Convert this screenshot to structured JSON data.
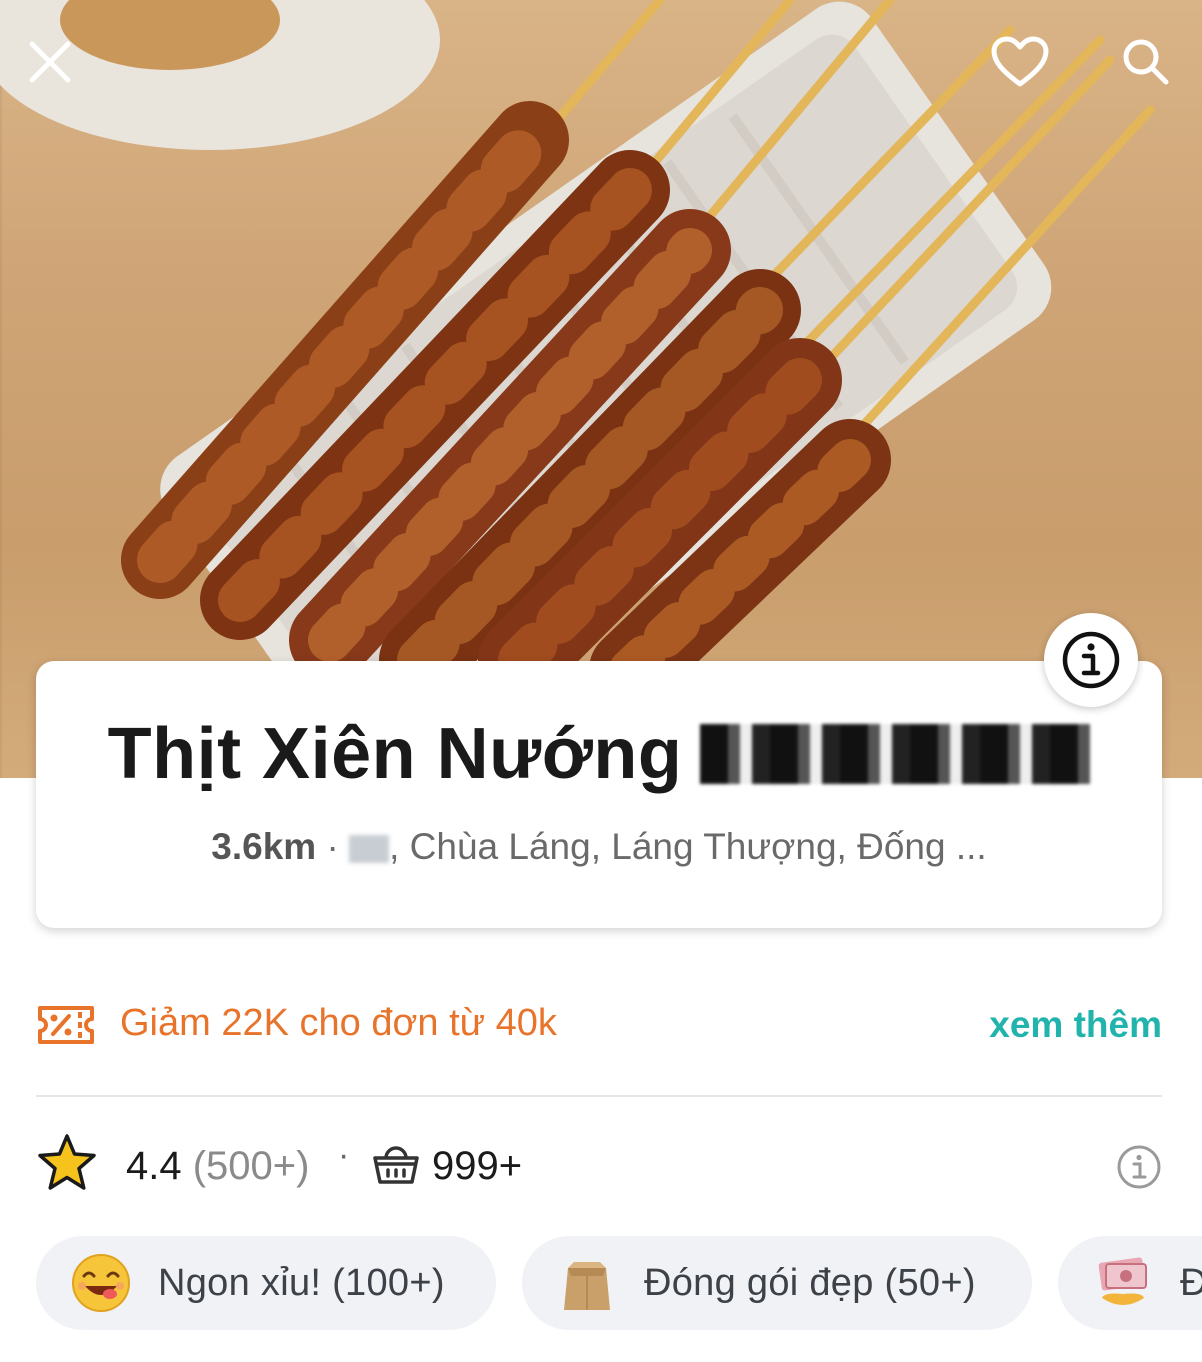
{
  "hero": {
    "close_icon": "close-icon",
    "favorite_icon": "heart-icon",
    "search_icon": "search-icon"
  },
  "store": {
    "name": "Thịt Xiên Nướng",
    "distance": "3.6km",
    "separator": " · ",
    "address": ", Chùa Láng, Láng Thượng, Đống ..."
  },
  "promo": {
    "icon": "discount-ticket-icon",
    "text": "Giảm 22K cho đơn từ 40k",
    "more_label": "xem thêm",
    "accent_color": "#e8742c",
    "link_color": "#22b4ac"
  },
  "stats": {
    "rating": "4.4",
    "rating_count": "(500+)",
    "dot": "·",
    "orders": "999+"
  },
  "chips": [
    {
      "label": "Ngon xỉu! (100+)",
      "icon": "yummy-face-icon"
    },
    {
      "label": "Đóng gói đẹp (50+)",
      "icon": "paper-bag-icon"
    },
    {
      "label": "Đ",
      "icon": "money-icon"
    }
  ]
}
